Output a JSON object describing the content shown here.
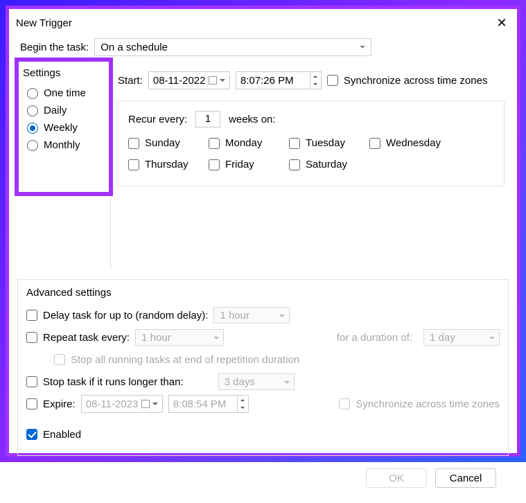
{
  "title": "New Trigger",
  "begin": {
    "label": "Begin the task:",
    "value": "On a schedule"
  },
  "settings": {
    "header": "Settings",
    "options": {
      "one_time": "One time",
      "daily": "Daily",
      "weekly": "Weekly",
      "monthly": "Monthly"
    },
    "selected": "weekly"
  },
  "start": {
    "label": "Start:",
    "date": "08-11-2022",
    "time": "8:07:26 PM",
    "sync_label": "Synchronize across time zones"
  },
  "weekly": {
    "recur_label": "Recur every:",
    "recur_value": "1",
    "weeks_on": "weeks on:",
    "days": {
      "sunday": "Sunday",
      "monday": "Monday",
      "tuesday": "Tuesday",
      "wednesday": "Wednesday",
      "thursday": "Thursday",
      "friday": "Friday",
      "saturday": "Saturday"
    }
  },
  "advanced": {
    "header": "Advanced settings",
    "delay_label": "Delay task for up to (random delay):",
    "delay_value": "1 hour",
    "repeat_label": "Repeat task every:",
    "repeat_value": "1 hour",
    "duration_label": "for a duration of:",
    "duration_value": "1 day",
    "stop_rep_label": "Stop all running tasks at end of repetition duration",
    "stop_long_label": "Stop task if it runs longer than:",
    "stop_long_value": "3 days",
    "expire_label": "Expire:",
    "expire_date": "08-11-2023",
    "expire_time": "8:08:54 PM",
    "expire_sync_label": "Synchronize across time zones",
    "enabled_label": "Enabled"
  },
  "buttons": {
    "ok": "OK",
    "cancel": "Cancel"
  }
}
